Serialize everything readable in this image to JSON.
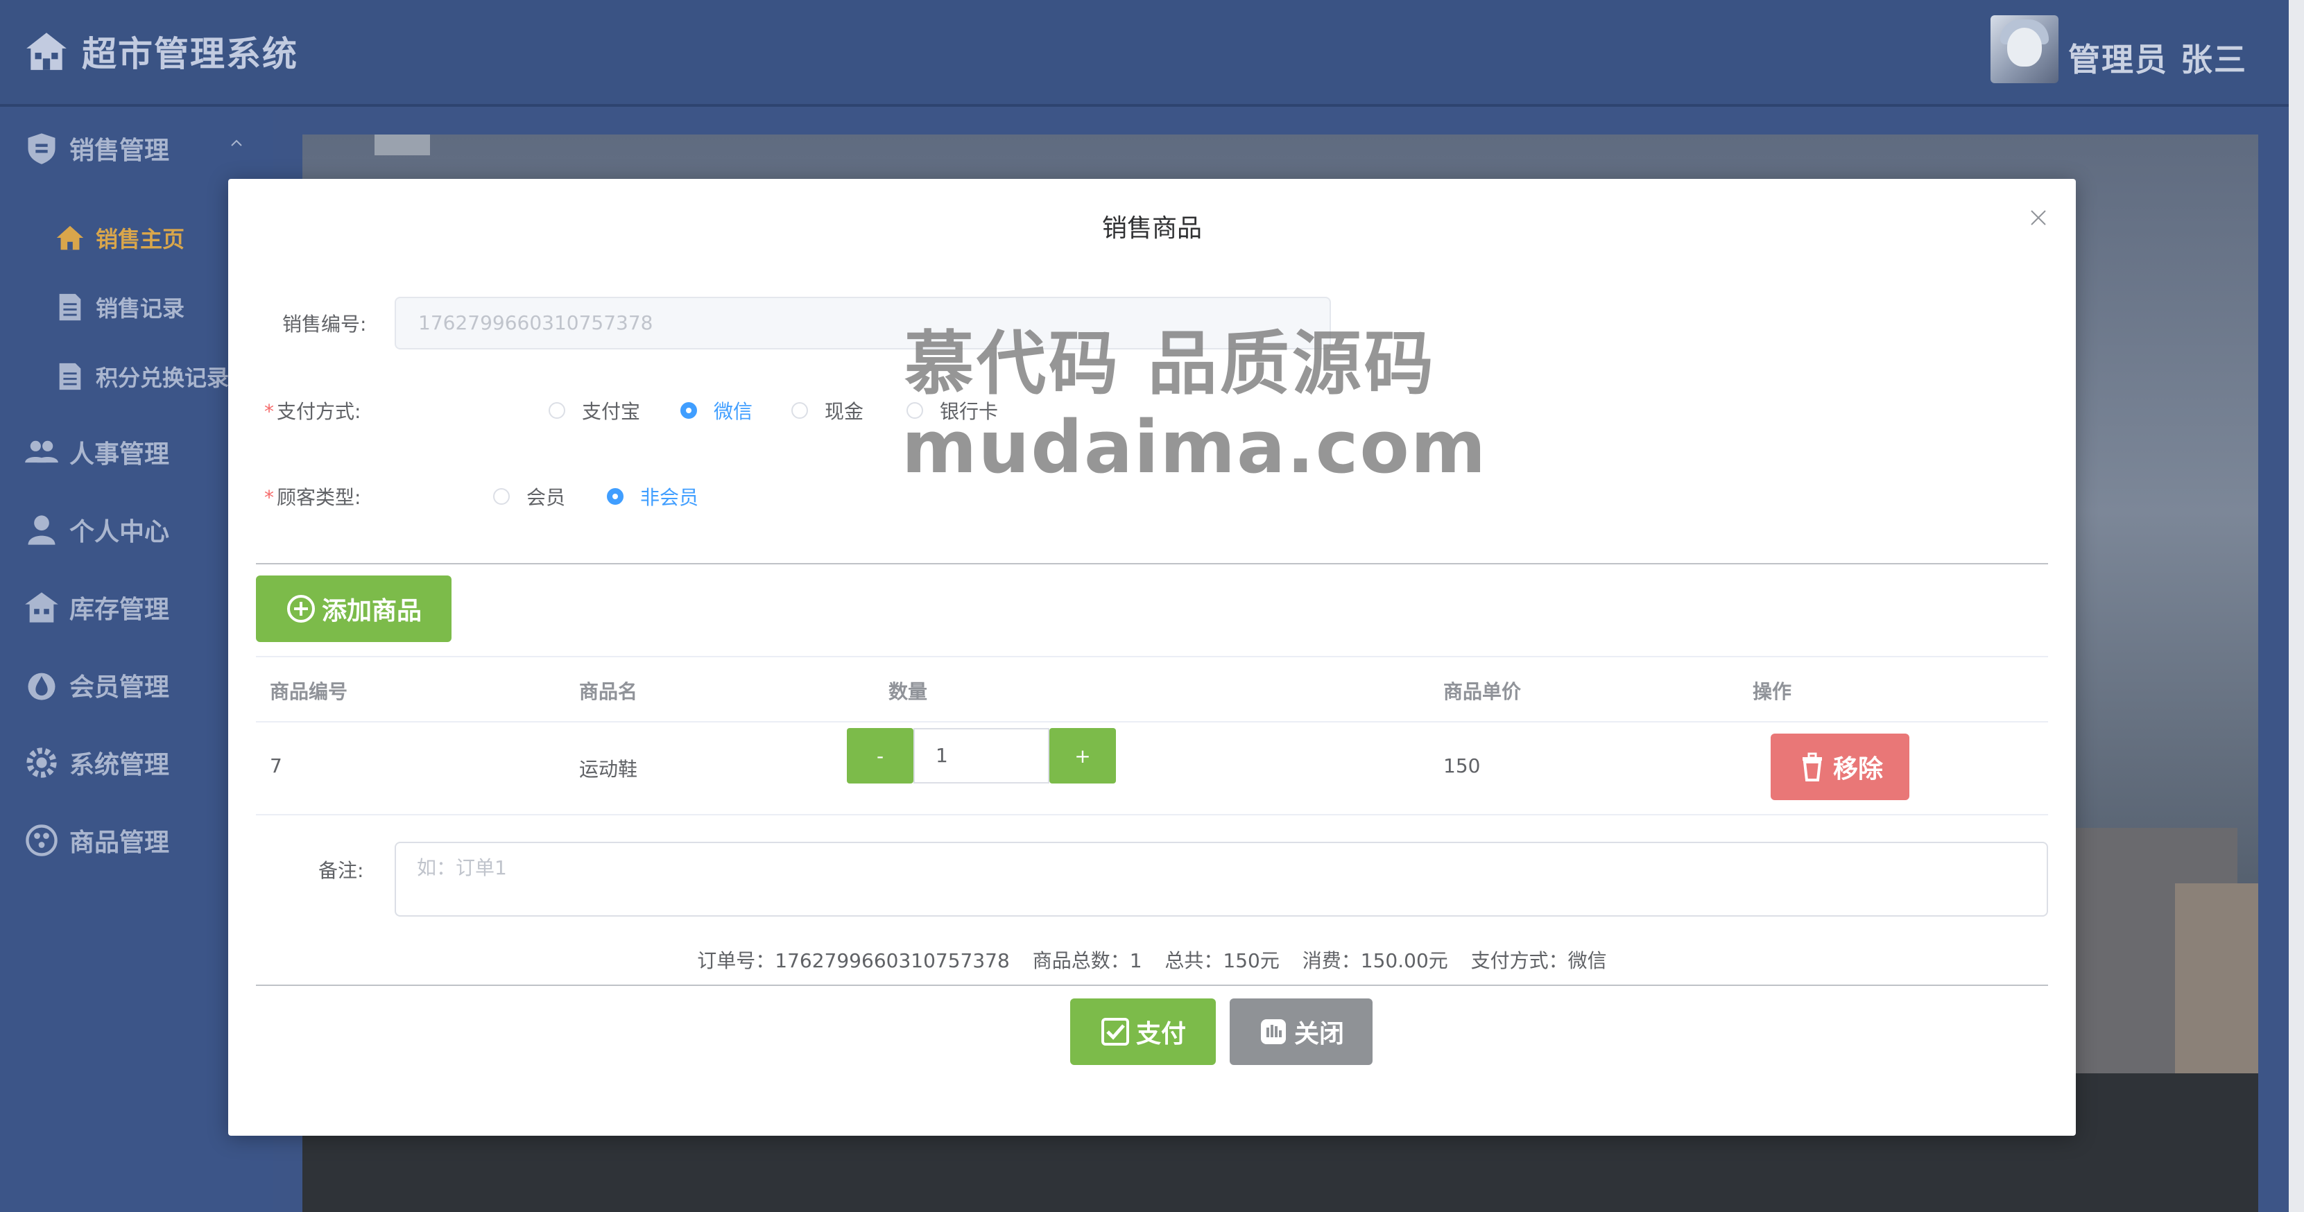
{
  "app": {
    "title": "超市管理系统",
    "user_name": "管理员 张三"
  },
  "sidebar": {
    "group_sales": "销售管理",
    "sub_items": [
      "销售主页",
      "销售记录",
      "积分兑换记录"
    ],
    "items": [
      "人事管理",
      "个人中心",
      "库存管理",
      "会员管理",
      "系统管理",
      "商品管理"
    ]
  },
  "dialog": {
    "title": "销售商品",
    "sale_no_label": "销售编号:",
    "sale_no_value": "1762799660310757378",
    "payment_label": "支付方式:",
    "payment_options": [
      "支付宝",
      "微信",
      "现金",
      "银行卡"
    ],
    "payment_selected": "微信",
    "customer_label": "顾客类型:",
    "customer_options": [
      "会员",
      "非会员"
    ],
    "customer_selected": "非会员",
    "add_button": "添加商品",
    "table": {
      "headers": [
        "商品编号",
        "商品名",
        "数量",
        "商品单价",
        "操作"
      ],
      "rows": [
        {
          "id": "7",
          "name": "运动鞋",
          "qty": "1",
          "price": "150",
          "minus": "-",
          "plus": "+",
          "action": "移除"
        }
      ]
    },
    "remark_label": "备注:",
    "remark_placeholder": "如：订单1",
    "summary": {
      "order": "订单号：1762799660310757378",
      "count": "商品总数：1",
      "total": "总共：150元",
      "spend": "消费：150.00元",
      "pay": "支付方式：微信"
    },
    "pay_button": "支付",
    "close_button": "关闭"
  },
  "watermark": {
    "line1": "慕代码 品质源码",
    "line2": "mudaima.com"
  },
  "colors": {
    "header": "#3a5384",
    "sidebar": "#3c5588",
    "green": "#7cbb4a",
    "red": "#e97777",
    "gray": "#8f9296",
    "primary": "#409eff",
    "active_sub": "#d9a64b"
  }
}
